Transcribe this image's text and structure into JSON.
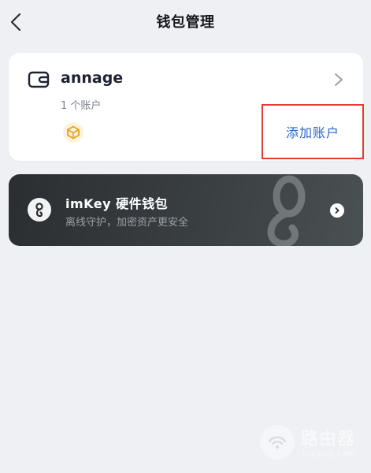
{
  "header": {
    "title": "钱包管理",
    "back_icon": "chevron-left-icon"
  },
  "wallet": {
    "icon": "wallet-icon",
    "name": "annage",
    "account_count": "1 个账户",
    "chain_badge_icon": "chain-cube-icon",
    "add_account_label": "添加账户",
    "arrow_icon": "chevron-right-icon"
  },
  "imkey": {
    "logo_icon": "imkey-logo-icon",
    "title": "imKey 硬件钱包",
    "subtitle": "离线守护，加密资产更安全",
    "go_icon": "chevron-right-circle-icon"
  },
  "watermark": {
    "text": "路由器",
    "url": "luyouqi.com"
  },
  "colors": {
    "background": "#eef0f4",
    "card": "#ffffff",
    "link_blue": "#2a66c9",
    "highlight_red": "#e53935",
    "imkey_dark": "#2b2e31"
  }
}
